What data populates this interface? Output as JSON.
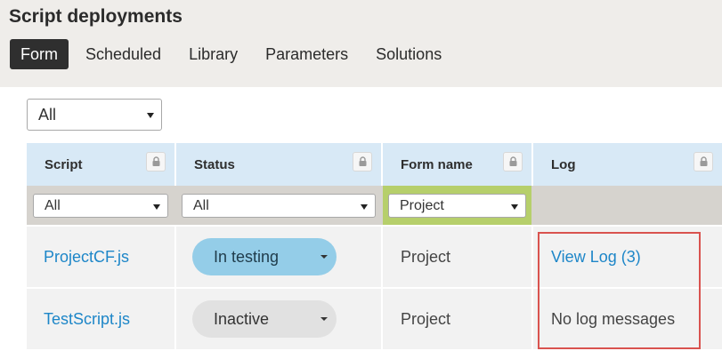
{
  "page": {
    "title": "Script deployments"
  },
  "tabs": [
    {
      "label": "Form",
      "active": true
    },
    {
      "label": "Scheduled",
      "active": false
    },
    {
      "label": "Library",
      "active": false
    },
    {
      "label": "Parameters",
      "active": false
    },
    {
      "label": "Solutions",
      "active": false
    }
  ],
  "top_filter": {
    "value": "All"
  },
  "columns": [
    {
      "label": "Script",
      "icon": "lock-icon"
    },
    {
      "label": "Status",
      "icon": "lock-icon"
    },
    {
      "label": "Form name",
      "icon": "lock-icon"
    },
    {
      "label": "Log",
      "icon": "lock-icon"
    }
  ],
  "filters": {
    "script": "All",
    "status": "All",
    "form_name": "Project"
  },
  "rows": [
    {
      "script": "ProjectCF.js",
      "status": "In testing",
      "form_name": "Project",
      "log": "View Log (3)"
    },
    {
      "script": "TestScript.js",
      "status": "Inactive",
      "form_name": "Project",
      "log": "No log messages"
    }
  ],
  "colors": {
    "header_bg": "#d8e9f6",
    "filter_row_bg": "#d6d3ce",
    "form_filter_highlight": "#b6cf6b",
    "link": "#1d86c8",
    "status_testing": "#94cde8",
    "status_inactive": "#e1e1e1",
    "callout_border": "#d9534f"
  }
}
